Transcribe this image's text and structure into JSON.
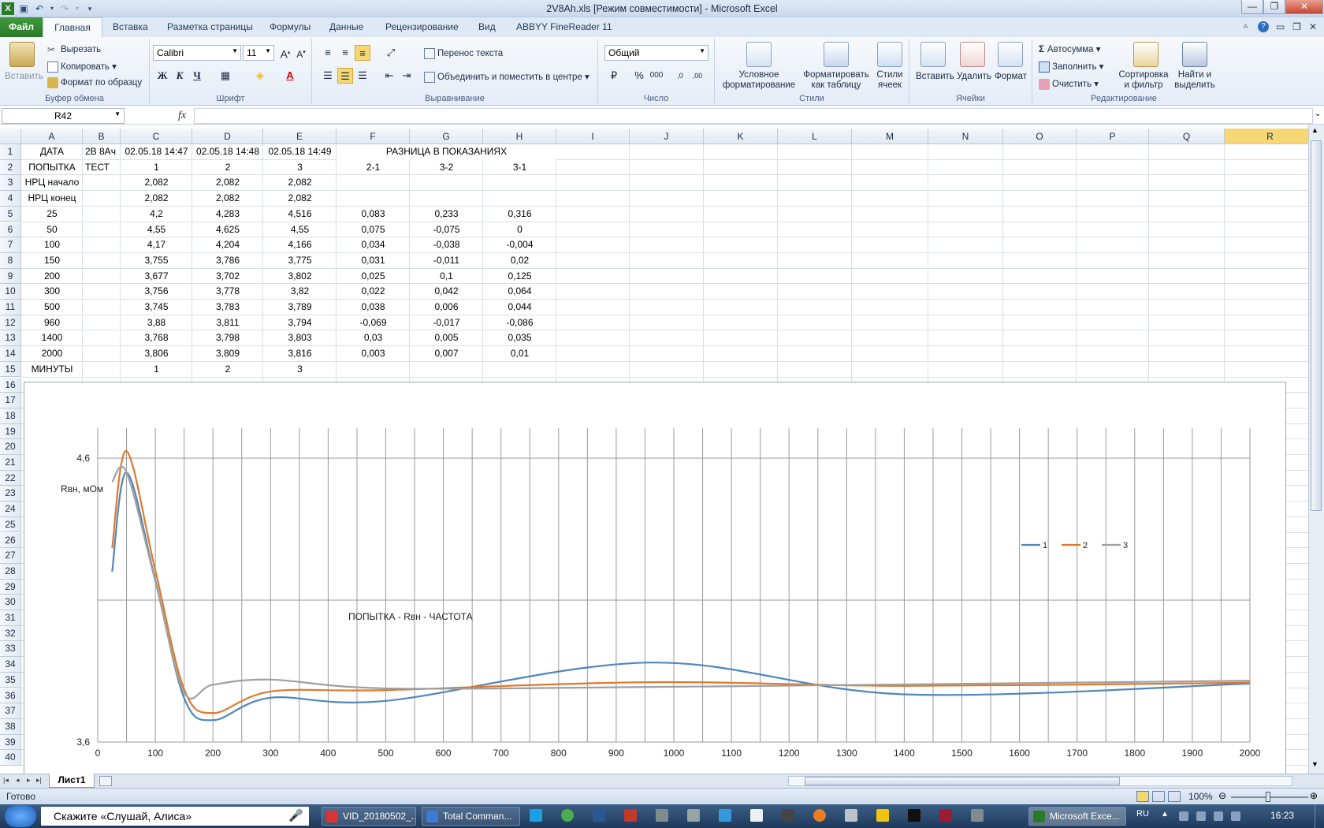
{
  "app": {
    "title": "2V8Ah.xls  [Режим совместимости]  -  Microsoft Excel"
  },
  "tabs": [
    "Главная",
    "Вставка",
    "Разметка страницы",
    "Формулы",
    "Данные",
    "Рецензирование",
    "Вид",
    "ABBYY FineReader 11"
  ],
  "file_tab": "Файл",
  "ribbon": {
    "clipboard": {
      "paste": "Вставить",
      "cut": "Вырезать",
      "copy": "Копировать",
      "format_painter": "Формат по образцу",
      "label": "Буфер обмена"
    },
    "font": {
      "name": "Calibri",
      "size": "11",
      "label": "Шрифт",
      "bold": "Ж",
      "italic": "К",
      "underline": "Ч"
    },
    "alignment": {
      "wrap": "Перенос текста",
      "merge": "Объединить и поместить в центре",
      "label": "Выравнивание"
    },
    "number": {
      "format": "Общий",
      "label": "Число",
      "percent": "%",
      "thousands": "000"
    },
    "styles": {
      "conditional": [
        "Условное",
        "форматирование"
      ],
      "as_table": [
        "Форматировать",
        "как таблицу"
      ],
      "cell_styles": [
        "Стили",
        "ячеек"
      ],
      "label": "Стили"
    },
    "cells": {
      "insert": "Вставить",
      "delete": "Удалить",
      "format": "Формат",
      "label": "Ячейки"
    },
    "editing": {
      "autosum": "Автосумма",
      "fill": "Заполнить",
      "clear": "Очистить",
      "sort": [
        "Сортировка",
        "и фильтр"
      ],
      "find": [
        "Найти и",
        "выделить"
      ],
      "label": "Редактирование"
    }
  },
  "formula_bar": {
    "name_box": "R42",
    "fx": "fx",
    "formula": ""
  },
  "columns": [
    "A",
    "B",
    "C",
    "D",
    "E",
    "F",
    "G",
    "H",
    "I",
    "J",
    "K",
    "L",
    "M",
    "N",
    "O",
    "P",
    "Q",
    "R"
  ],
  "rows": [
    [
      "ДАТА",
      "2В 8Ач",
      "02.05.18 14:47",
      "02.05.18 14:48",
      "02.05.18 14:49",
      "",
      "",
      "",
      "",
      "",
      "",
      "",
      "",
      "",
      "",
      "",
      "",
      ""
    ],
    [
      "ПОПЫТКА",
      "ТЕСТ",
      "1",
      "2",
      "3",
      "2-1",
      "3-2",
      "3-1",
      "",
      "",
      "",
      "",
      "",
      "",
      "",
      "",
      "",
      ""
    ],
    [
      "НРЦ начало",
      "",
      "2,082",
      "2,082",
      "2,082",
      "",
      "",
      "",
      "",
      "",
      "",
      "",
      "",
      "",
      "",
      "",
      "",
      ""
    ],
    [
      "НРЦ конец",
      "",
      "2,082",
      "2,082",
      "2,082",
      "",
      "",
      "",
      "",
      "",
      "",
      "",
      "",
      "",
      "",
      "",
      "",
      ""
    ],
    [
      "25",
      "",
      "4,2",
      "4,283",
      "4,516",
      "0,083",
      "0,233",
      "0,316",
      "",
      "",
      "",
      "",
      "",
      "",
      "",
      "",
      "",
      ""
    ],
    [
      "50",
      "",
      "4,55",
      "4,625",
      "4,55",
      "0,075",
      "-0,075",
      "0",
      "",
      "",
      "",
      "",
      "",
      "",
      "",
      "",
      "",
      ""
    ],
    [
      "100",
      "",
      "4,17",
      "4,204",
      "4,166",
      "0,034",
      "-0,038",
      "-0,004",
      "",
      "",
      "",
      "",
      "",
      "",
      "",
      "",
      "",
      ""
    ],
    [
      "150",
      "",
      "3,755",
      "3,786",
      "3,775",
      "0,031",
      "-0,011",
      "0,02",
      "",
      "",
      "",
      "",
      "",
      "",
      "",
      "",
      "",
      ""
    ],
    [
      "200",
      "",
      "3,677",
      "3,702",
      "3,802",
      "0,025",
      "0,1",
      "0,125",
      "",
      "",
      "",
      "",
      "",
      "",
      "",
      "",
      "",
      ""
    ],
    [
      "300",
      "",
      "3,756",
      "3,778",
      "3,82",
      "0,022",
      "0,042",
      "0,064",
      "",
      "",
      "",
      "",
      "",
      "",
      "",
      "",
      "",
      ""
    ],
    [
      "500",
      "",
      "3,745",
      "3,783",
      "3,789",
      "0,038",
      "0,006",
      "0,044",
      "",
      "",
      "",
      "",
      "",
      "",
      "",
      "",
      "",
      ""
    ],
    [
      "960",
      "",
      "3,88",
      "3,811",
      "3,794",
      "-0,069",
      "-0,017",
      "-0,086",
      "",
      "",
      "",
      "",
      "",
      "",
      "",
      "",
      "",
      ""
    ],
    [
      "1400",
      "",
      "3,768",
      "3,798",
      "3,803",
      "0,03",
      "0,005",
      "0,035",
      "",
      "",
      "",
      "",
      "",
      "",
      "",
      "",
      "",
      ""
    ],
    [
      "2000",
      "",
      "3,806",
      "3,809",
      "3,816",
      "0,003",
      "0,007",
      "0,01",
      "",
      "",
      "",
      "",
      "",
      "",
      "",
      "",
      "",
      ""
    ],
    [
      "МИНУТЫ",
      "",
      "1",
      "2",
      "3",
      "",
      "",
      "",
      "",
      "",
      "",
      "",
      "",
      "",
      "",
      "",
      "",
      ""
    ]
  ],
  "merged_header": "РАЗНИЦА В ПОКАЗАНИЯХ",
  "row_numbers": [
    "1",
    "2",
    "3",
    "4",
    "5",
    "6",
    "7",
    "8",
    "9",
    "10",
    "11",
    "12",
    "13",
    "14",
    "15",
    "16",
    "17",
    "18",
    "19",
    "20",
    "21",
    "22",
    "23",
    "24",
    "25",
    "26",
    "27",
    "28",
    "29",
    "30",
    "31",
    "32",
    "33",
    "34",
    "35",
    "36",
    "37",
    "38",
    "39",
    "40"
  ],
  "chart_data": {
    "type": "line",
    "title": "ПОПЫТКА - Rвн - ЧАСТОТА",
    "ylabel": "Rвн, мОм",
    "xlim": [
      0,
      2000
    ],
    "ylim": [
      3.6,
      4.6
    ],
    "x_ticks": [
      "0",
      "100",
      "200",
      "300",
      "400",
      "500",
      "600",
      "700",
      "800",
      "900",
      "1000",
      "1100",
      "1200",
      "1300",
      "1400",
      "1500",
      "1600",
      "1700",
      "1800",
      "1900",
      "2000"
    ],
    "y_ticks": [
      "3,6",
      "4,6"
    ],
    "legend_position": "right",
    "x": [
      25,
      50,
      100,
      150,
      200,
      300,
      500,
      960,
      1400,
      2000
    ],
    "series": [
      {
        "name": "1",
        "color": "#4f86bd",
        "values": [
          4.2,
          4.55,
          4.17,
          3.755,
          3.677,
          3.756,
          3.745,
          3.88,
          3.768,
          3.806
        ]
      },
      {
        "name": "2",
        "color": "#e0782c",
        "values": [
          4.283,
          4.625,
          4.204,
          3.786,
          3.702,
          3.778,
          3.783,
          3.811,
          3.798,
          3.809
        ]
      },
      {
        "name": "3",
        "color": "#a0a0a0",
        "values": [
          4.516,
          4.55,
          4.166,
          3.775,
          3.802,
          3.82,
          3.789,
          3.794,
          3.803,
          3.816
        ]
      }
    ]
  },
  "sheet_tab": "Лист1",
  "status": {
    "ready": "Готово",
    "zoom": "100%"
  },
  "taskbar": {
    "search": "Скажите «Слушай, Алиса»",
    "items": [
      "VID_20180502_...",
      "Total Comman...",
      "Microsoft Exce..."
    ],
    "lang": "RU",
    "time": "16:23"
  },
  "colors": {
    "excel_green": "#2b7a2a",
    "selected_col": "#f5d776",
    "ribbon_bg": "#e4ecf7"
  }
}
